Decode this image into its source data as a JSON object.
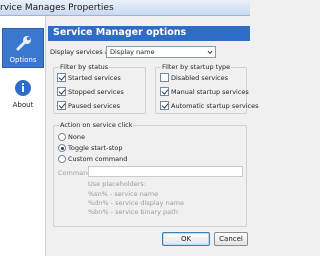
{
  "window": {
    "title": "rvice Manages Properties"
  },
  "nav": {
    "items": [
      {
        "label": "Options",
        "icon": "wrench-icon",
        "selected": true
      },
      {
        "label": "About",
        "icon": "info-icon",
        "selected": false
      }
    ]
  },
  "panel": {
    "title": "Service Manager options",
    "display_label": "Display services as:",
    "display_value": "Display name"
  },
  "filter_status": {
    "title": "Filter by status",
    "items": [
      {
        "label": "Started services",
        "checked": true
      },
      {
        "label": "Stopped services",
        "checked": true
      },
      {
        "label": "Paused services",
        "checked": true
      }
    ]
  },
  "filter_startup": {
    "title": "Filter by startup type",
    "items": [
      {
        "label": "Disabled services",
        "checked": false
      },
      {
        "label": "Manual startup services",
        "checked": true
      },
      {
        "label": "Automatic startup services",
        "checked": true
      }
    ]
  },
  "action": {
    "title": "Action on service click",
    "options": [
      {
        "label": "None",
        "selected": false
      },
      {
        "label": "Toggle start-stop",
        "selected": true
      },
      {
        "label": "Custom command",
        "selected": false
      }
    ],
    "command_label": "Command",
    "command_value": "",
    "placeholders_title": "Use placeholders:",
    "placeholders": [
      "%sn% - service name",
      "%dn% - service display name",
      "%bn% - service binary path"
    ]
  },
  "buttons": {
    "ok": "OK",
    "cancel": "Cancel"
  },
  "colors": {
    "accent": "#2f6cc8",
    "nav_selected": "#3a78d0"
  }
}
